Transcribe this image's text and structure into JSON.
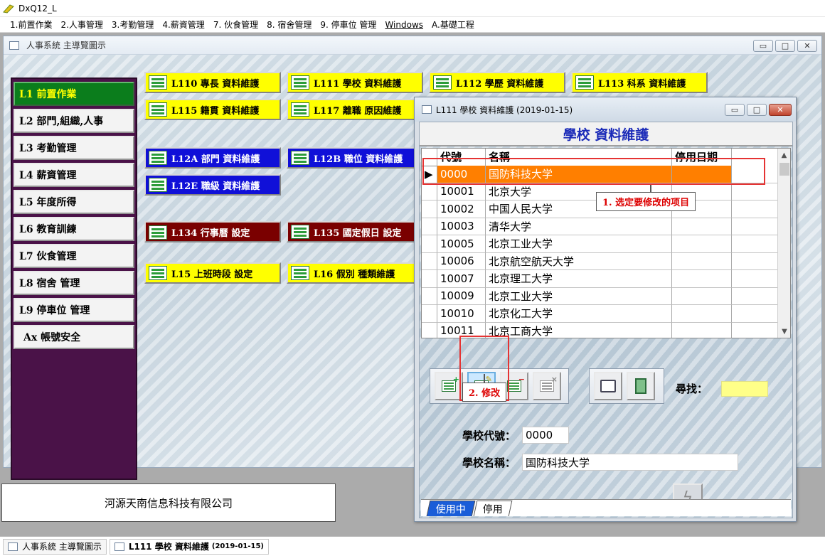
{
  "app": {
    "title": "DxQ12_L"
  },
  "menu": [
    "1.前置作業",
    "2.人事管理",
    "3.考勤管理",
    "4.薪資管理",
    "7. 伙食管理",
    "8. 宿舍管理",
    "9. 停車位 管理",
    "Windows",
    "A.基礎工程"
  ],
  "main_window": {
    "title": "人事系統 主導覽圖示",
    "ctrl_min": "▭",
    "ctrl_max": "□",
    "ctrl_close": "✕"
  },
  "side_nav": [
    {
      "label": "L1  前置作業",
      "active": true
    },
    {
      "label": "L2  部門,組織,人事",
      "active": false
    },
    {
      "label": "L3  考勤管理",
      "active": false
    },
    {
      "label": "L4  薪資管理",
      "active": false
    },
    {
      "label": "L5  年度所得",
      "active": false
    },
    {
      "label": "L6  教育訓練",
      "active": false
    },
    {
      "label": "L7  伙食管理",
      "active": false
    },
    {
      "label": "L8  宿舍 管理",
      "active": false
    },
    {
      "label": "L9  停車位 管理",
      "active": false
    },
    {
      "label": "Ax  帳號安全",
      "active": false
    }
  ],
  "tiles": {
    "l110": "L110  專長  資料維護",
    "l111": "L111  學校  資料維護",
    "l112": "L112  學歷  資料維護",
    "l113": "L113  科系  資料維護",
    "l115": "L115  籍貫  資料維護",
    "l117": "L117  離職  原因維護",
    "l12a": "L12A  部門  資料維護",
    "l12b": "L12B  職位  資料維護",
    "l12e": "L12E  職級  資料維護",
    "l134": "L134  行事曆  設定",
    "l135": "L135  國定假日  設定",
    "l15": "L15  上班時段  設定",
    "l16": "L16  假別  種類維護"
  },
  "company": "河源天南信息科技有限公司",
  "taskbar": {
    "main": "人事系統 主導覽圖示",
    "dialog": "L111 學校 資料維護",
    "dialog_date": "(2019-01-15)"
  },
  "dialog": {
    "title": "L111 學校 資料維護 (2019-01-15)",
    "header": "學校 資料維護",
    "columns": [
      "代號",
      "名稱",
      "停用日期"
    ],
    "rows": [
      {
        "code": "0000",
        "name": "国防科技大学",
        "date": "",
        "selected": true
      },
      {
        "code": "10001",
        "name": "北京大学",
        "date": ""
      },
      {
        "code": "10002",
        "name": "中国人民大学",
        "date": ""
      },
      {
        "code": "10003",
        "name": "清华大学",
        "date": ""
      },
      {
        "code": "10005",
        "name": "北京工业大学",
        "date": ""
      },
      {
        "code": "10006",
        "name": "北京航空航天大学",
        "date": ""
      },
      {
        "code": "10007",
        "name": "北京理工大学",
        "date": ""
      },
      {
        "code": "10009",
        "name": "北京工业大学",
        "date": ""
      },
      {
        "code": "10010",
        "name": "北京化工大学",
        "date": ""
      },
      {
        "code": "10011",
        "name": "北京工商大学",
        "date": ""
      }
    ],
    "row_indicator": "▶",
    "search_label": "尋找：",
    "search_value": "",
    "school_code_label": "學校代號：",
    "school_code_value": "0000",
    "school_name_label": "學校名稱：",
    "school_name_value": "国防科技大学",
    "tabs": [
      "使用中",
      "停用"
    ],
    "ctrl_min": "▭",
    "ctrl_max": "□",
    "ctrl_close": "✕"
  },
  "annotations": {
    "step1": "1. 选定要修改的项目",
    "step2": "2. 修改"
  },
  "icons": {
    "add": "add-record-icon",
    "edit": "edit-record-icon",
    "delete": "delete-record-icon",
    "disable": "disable-record-icon",
    "print": "print-icon",
    "exit": "exit-icon",
    "save": "save-lightning-icon"
  },
  "colors": {
    "accent_orange": "#ff7f00",
    "nav_active": "#0b7d1c",
    "nav_bg": "#4a1248",
    "annotation_red": "#e53333"
  }
}
